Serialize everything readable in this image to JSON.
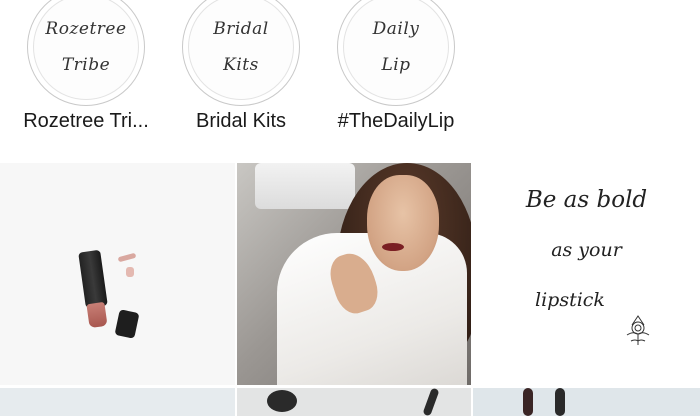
{
  "highlights": [
    {
      "label": "Rozetree Tri...",
      "cover_lines": [
        "Rozetree",
        "Tribe"
      ]
    },
    {
      "label": "Bridal Kits",
      "cover_lines": [
        "Bridal",
        "Kits"
      ]
    },
    {
      "label": "#TheDailyLip",
      "cover_lines": [
        "Daily",
        "Lip"
      ]
    }
  ],
  "posts": [
    {
      "kind": "lipstick flat lay"
    },
    {
      "kind": "portrait applying lipstick"
    },
    {
      "kind": "quote",
      "lines": [
        "Be as bold",
        "as your",
        "lipstick"
      ]
    },
    {
      "kind": "partial"
    },
    {
      "kind": "partial"
    },
    {
      "kind": "partial"
    }
  ]
}
